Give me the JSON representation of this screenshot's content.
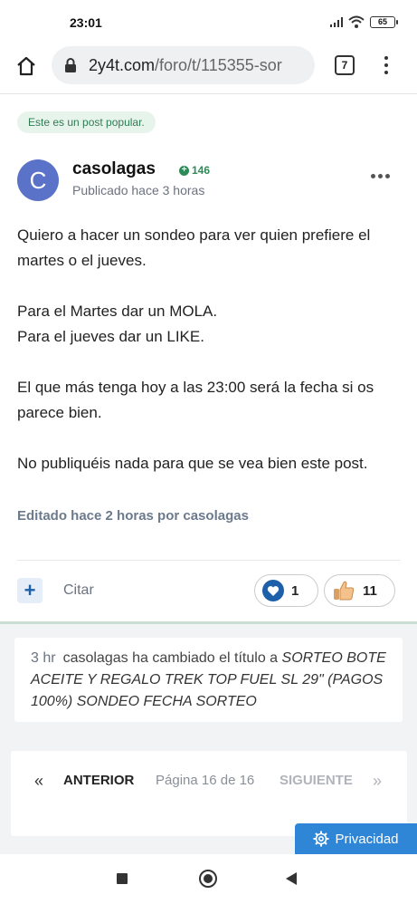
{
  "status_bar": {
    "time": "23:01",
    "battery": "65"
  },
  "browser": {
    "url_domain": "2y4t.com",
    "url_path": "/foro/t/115355-sor",
    "tab_count": "7"
  },
  "post": {
    "popular_badge": "Este es un post popular.",
    "avatar_letter": "C",
    "author": "casolagas",
    "reputation": "146",
    "published": "Publicado hace 3 horas",
    "paragraphs": [
      "Quiero a hacer un sondeo para ver quien prefiere el martes o el jueves.",
      "Para el Martes dar un  MOLA.",
      "Para el jueves dar un LIKE.",
      "El que más tenga hoy a las 23:00 será la fecha si os parece bien.",
      "No publiquéis nada para que se vea bien este post."
    ],
    "edited": "Editado hace 2 horas por casolagas",
    "quote_label": "Citar",
    "reactions": {
      "love_count": "1",
      "like_count": "11"
    }
  },
  "event": {
    "ago": "3 hr",
    "text": "casolagas ha cambiado el título a",
    "new_title": "SORTEO BOTE ACEITE Y REGALO TREK TOP FUEL SL 29\" (PAGOS 100%) SONDEO FECHA SORTEO"
  },
  "pagination": {
    "prev_icon": "«",
    "prev_label": "ANTERIOR",
    "page_info": "Página 16 de 16",
    "next_label": "SIGUIENTE",
    "next_icon": "»"
  },
  "privacy_label": "Privacidad",
  "colors": {
    "accent_blue": "#1d5fa8",
    "badge_green": "#2e7d52",
    "avatar": "#5b72c9",
    "privacy_button": "#2f86d6"
  }
}
